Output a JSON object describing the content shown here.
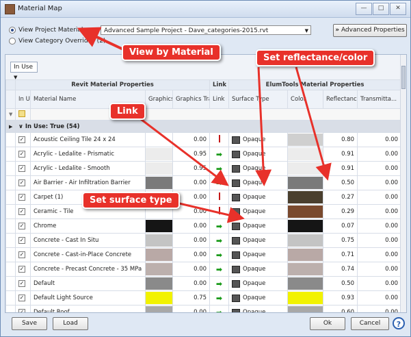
{
  "window": {
    "title": "Material Map",
    "buttons": [
      "—",
      "□",
      "✕"
    ]
  },
  "top": {
    "radio_project": "View Project Materials",
    "radio_category": "View Category Overrides (2)",
    "project_select": "Advanced Sample Project - Dave_categories-2015.rvt",
    "advanced_button": "Advanced Properties"
  },
  "filter": {
    "dropdown": "In Use"
  },
  "grid": {
    "group_headers": [
      "Revit Material Properties",
      "Link",
      "ElumTools Material Properties"
    ],
    "columns": [
      "In Use",
      "Material Name",
      "Graphics Color",
      "Graphics Transparency",
      "Link",
      "Surface Type",
      "Color",
      "Reflectance",
      "Transmitta..."
    ],
    "group_row": "In Use: True  (54)",
    "rows": [
      {
        "name": "Acoustic Ceiling Tile 24 x 24",
        "gcolor": "#ffffff",
        "gtrans": "0.00",
        "link": "bar",
        "surface": "Opaque",
        "color": "#cfcfcf",
        "refl": "0.80",
        "trans": "0.00"
      },
      {
        "name": "Acrylic - Ledalite - Prismatic",
        "gcolor": "#ececec",
        "gtrans": "0.95",
        "link": "arrow",
        "surface": "Opaque",
        "color": "#ececec",
        "refl": "0.91",
        "trans": "0.00"
      },
      {
        "name": "Acrylic - Ledalite - Smooth",
        "gcolor": "#ececec",
        "gtrans": "0.95",
        "link": "arrow",
        "surface": "Opaque",
        "color": "#ececec",
        "refl": "0.91",
        "trans": "0.00"
      },
      {
        "name": "Air Barrier - Air Infiltration Barrier",
        "gcolor": "#7a7a7a",
        "gtrans": "0.00",
        "link": "arrow",
        "surface": "Opaque",
        "color": "#7a7a7a",
        "refl": "0.50",
        "trans": "0.00"
      },
      {
        "name": "Carpet (1)",
        "gcolor": "#ffffff",
        "gtrans": "0.00",
        "link": "bar",
        "surface": "Opaque",
        "color": "#4a3f2e",
        "refl": "0.27",
        "trans": "0.00"
      },
      {
        "name": "Ceramic - Tile",
        "gcolor": "#ffffff",
        "gtrans": "0.00",
        "link": "bar",
        "surface": "Opaque",
        "color": "#7a4a2e",
        "refl": "0.29",
        "trans": "0.00"
      },
      {
        "name": "Chrome",
        "gcolor": "#151515",
        "gtrans": "0.00",
        "link": "arrow",
        "surface": "Opaque",
        "color": "#151515",
        "refl": "0.07",
        "trans": "0.00"
      },
      {
        "name": "Concrete - Cast In Situ",
        "gcolor": "#c4c4c4",
        "gtrans": "0.00",
        "link": "arrow",
        "surface": "Opaque",
        "color": "#c4c4c4",
        "refl": "0.75",
        "trans": "0.00"
      },
      {
        "name": "Concrete - Cast-in-Place Concrete",
        "gcolor": "#b9a9a6",
        "gtrans": "0.00",
        "link": "arrow",
        "surface": "Opaque",
        "color": "#b9a9a6",
        "refl": "0.71",
        "trans": "0.00"
      },
      {
        "name": "Concrete - Precast Concrete - 35 MPa",
        "gcolor": "#bcb0ad",
        "gtrans": "0.00",
        "link": "arrow",
        "surface": "Opaque",
        "color": "#bcb0ad",
        "refl": "0.74",
        "trans": "0.00"
      },
      {
        "name": "Default",
        "gcolor": "#8a8a8a",
        "gtrans": "0.00",
        "link": "arrow",
        "surface": "Opaque",
        "color": "#8a8a8a",
        "refl": "0.50",
        "trans": "0.00"
      },
      {
        "name": "Default Light Source",
        "gcolor": "#f2f200",
        "gtrans": "0.75",
        "link": "arrow",
        "surface": "Opaque",
        "color": "#f2f200",
        "refl": "0.93",
        "trans": "0.00"
      },
      {
        "name": "Default Roof",
        "gcolor": "#a8a8a8",
        "gtrans": "0.00",
        "link": "arrow",
        "surface": "Opaque",
        "color": "#a8a8a8",
        "refl": "0.60",
        "trans": "0.00"
      }
    ]
  },
  "callouts": {
    "view_by_material": "View by Material",
    "set_reflectance": "Set reflectance/color",
    "link": "Link",
    "set_surface": "Set surface type"
  },
  "bottom": {
    "save": "Save",
    "load": "Load",
    "ok": "Ok",
    "cancel": "Cancel",
    "help": "?"
  }
}
